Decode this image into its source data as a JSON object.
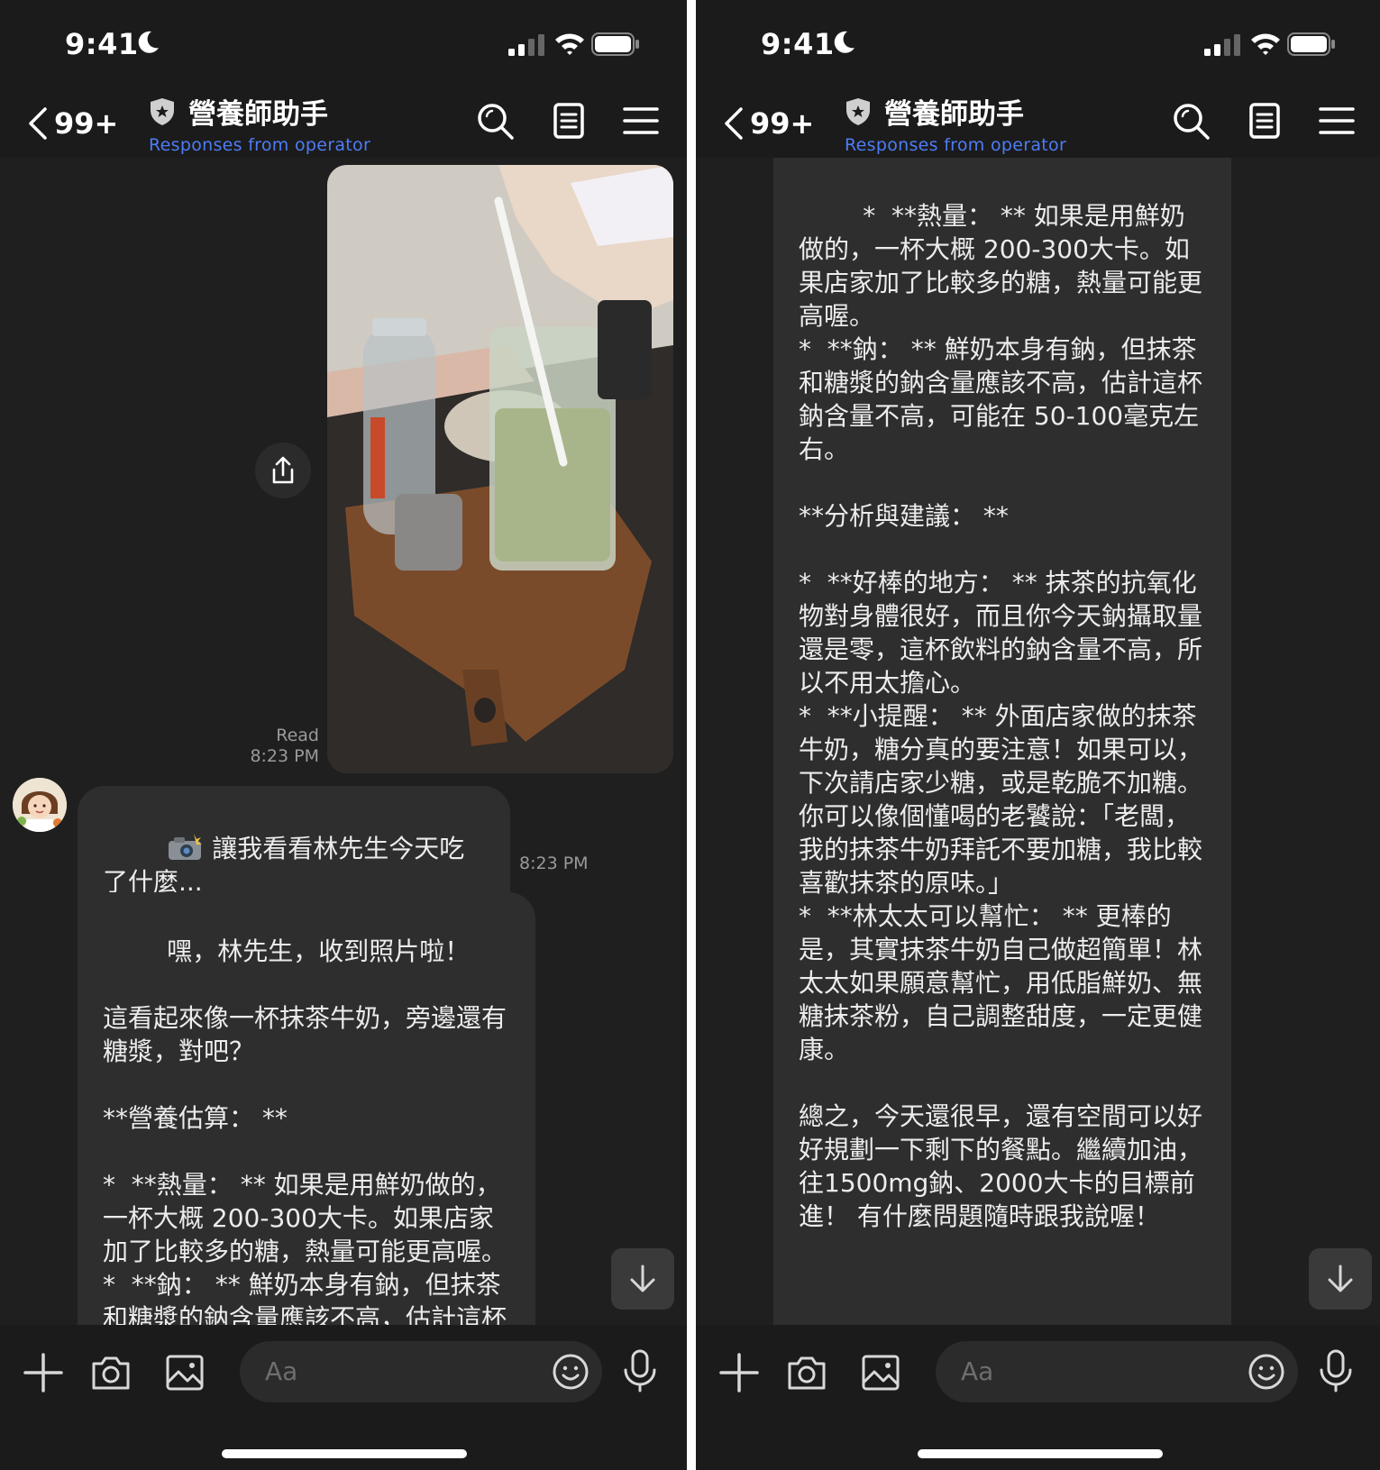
{
  "status": {
    "time": "9:41"
  },
  "header": {
    "back_count": "99+",
    "title": "營養師助手",
    "subtitle": "Responses from operator"
  },
  "icons": {
    "header": [
      "chevron-left-icon",
      "shield-icon",
      "search-icon",
      "notes-icon",
      "menu-icon"
    ],
    "composer": [
      "plus-icon",
      "camera-icon",
      "image-icon",
      "emoji-icon",
      "mic-icon"
    ]
  },
  "chat": {
    "photo_read": "Read",
    "photo_time": "8:23 PM",
    "bot_message_1": "讓我看看林先生今天吃了什麼...",
    "bot_message_1_time": "8:23 PM",
    "bot_message_2": "嘿，林先生，收到照片啦！\n\n這看起來像一杯抹茶牛奶，旁邊還有糖漿，對吧？\n\n**營養估算： **\n\n*  **熱量： ** 如果是用鮮奶做的，一杯大概 200-300大卡。如果店家加了比較多的糖，熱量可能更高喔。\n*  **鈉： ** 鮮奶本身有鈉，但抹茶和糖漿的鈉含量應該不高，估計這杯鈉含量不高，可能在50-100毫克左右。",
    "bot_message_2_continued": "*  **熱量： ** 如果是用鮮奶做的，一杯大概 200-300大卡。如果店家加了比較多的糖，熱量可能更高喔。\n*  **鈉： ** 鮮奶本身有鈉，但抹茶和糖漿的鈉含量應該不高，估計這杯鈉含量不高，可能在 50-100毫克左右。\n\n**分析與建議： **\n\n*  **好棒的地方： ** 抹茶的抗氧化物對身體很好，而且你今天鈉攝取量還是零，這杯飲料的鈉含量不高，所以不用太擔心。\n*  **小提醒： ** 外面店家做的抹茶牛奶，糖分真的要注意！如果可以，下次請店家少糖，或是乾脆不加糖。你可以像個懂喝的老饕說：「老闆，我的抹茶牛奶拜託不要加糖，我比較喜歡抹茶的原味。」\n*  **林太太可以幫忙： ** 更棒的是，其實抹茶牛奶自己做超簡單！林太太如果願意幫忙，用低脂鮮奶、無糖抹茶粉，自己調整甜度，一定更健康。\n\n總之，今天還很早，還有空間可以好好規劃一下剩下的餐點。繼續加油，往1500mg鈉、2000大卡的目標前進！ 有什麼問題隨時跟我說喔！"
  },
  "composer": {
    "placeholder": "Aa"
  },
  "colors": {
    "background": "#1f1f1f",
    "bubble": "#2e2e2e",
    "subtitle_blue": "#4d7cf5",
    "meta_gray": "#9a9a9a"
  }
}
